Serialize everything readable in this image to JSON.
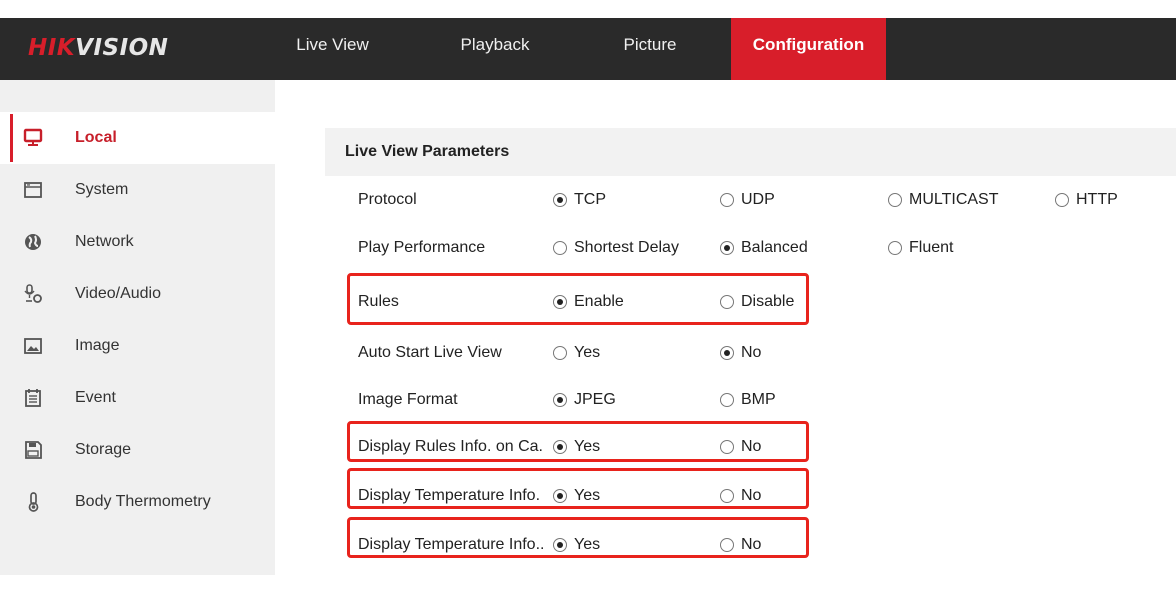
{
  "brand": {
    "part1": "HIK",
    "part2": "VISION"
  },
  "nav": [
    {
      "label": "Live View",
      "active": false
    },
    {
      "label": "Playback",
      "active": false
    },
    {
      "label": "Picture",
      "active": false
    },
    {
      "label": "Configuration",
      "active": true
    }
  ],
  "sidebar": [
    {
      "label": "Local",
      "icon": "monitor-icon",
      "active": true
    },
    {
      "label": "System",
      "icon": "window-icon",
      "active": false
    },
    {
      "label": "Network",
      "icon": "globe-icon",
      "active": false
    },
    {
      "label": "Video/Audio",
      "icon": "mic-camera-icon",
      "active": false
    },
    {
      "label": "Image",
      "icon": "image-icon",
      "active": false
    },
    {
      "label": "Event",
      "icon": "calendar-icon",
      "active": false
    },
    {
      "label": "Storage",
      "icon": "floppy-icon",
      "active": false
    },
    {
      "label": "Body Thermometry",
      "icon": "thermometer-icon",
      "active": false
    }
  ],
  "section_title": "Live View Parameters",
  "rows": [
    {
      "label": "Protocol",
      "options": [
        {
          "label": "TCP",
          "checked": true
        },
        {
          "label": "UDP",
          "checked": false
        },
        {
          "label": "MULTICAST",
          "checked": false
        },
        {
          "label": "HTTP",
          "checked": false
        }
      ]
    },
    {
      "label": "Play Performance",
      "options": [
        {
          "label": "Shortest Delay",
          "checked": false
        },
        {
          "label": "Balanced",
          "checked": true
        },
        {
          "label": "Fluent",
          "checked": false
        }
      ]
    },
    {
      "label": "Rules",
      "options": [
        {
          "label": "Enable",
          "checked": true
        },
        {
          "label": "Disable",
          "checked": false
        }
      ]
    },
    {
      "label": "Auto Start Live View",
      "options": [
        {
          "label": "Yes",
          "checked": false
        },
        {
          "label": "No",
          "checked": true
        }
      ]
    },
    {
      "label": "Image Format",
      "options": [
        {
          "label": "JPEG",
          "checked": true
        },
        {
          "label": "BMP",
          "checked": false
        }
      ]
    },
    {
      "label": "Display Rules Info. on Ca...",
      "options": [
        {
          "label": "Yes",
          "checked": true
        },
        {
          "label": "No",
          "checked": false
        }
      ]
    },
    {
      "label": "Display Temperature Info.",
      "options": [
        {
          "label": "Yes",
          "checked": true
        },
        {
          "label": "No",
          "checked": false
        }
      ]
    },
    {
      "label": "Display Temperature Info...",
      "options": [
        {
          "label": "Yes",
          "checked": true
        },
        {
          "label": "No",
          "checked": false
        }
      ]
    }
  ],
  "colors": {
    "accent": "#d81e2a",
    "header_bg": "#2a2a2a",
    "sidebar_bg": "#f0f0f0",
    "highlight": "#e8231c"
  }
}
